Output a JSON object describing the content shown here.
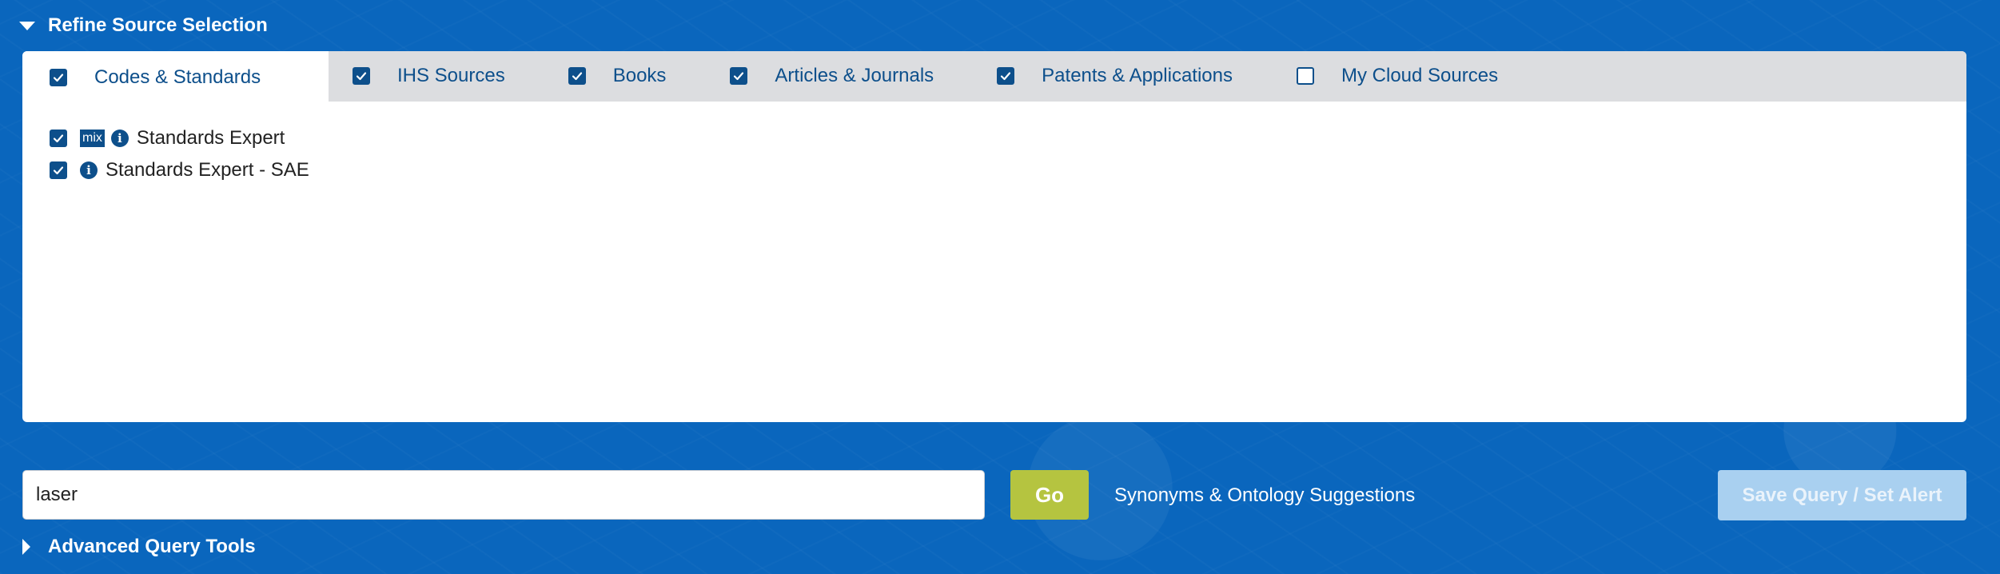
{
  "refine": {
    "title": "Refine Source Selection"
  },
  "tabs": [
    {
      "label": "Codes & Standards",
      "checked": true,
      "active": true
    },
    {
      "label": "IHS Sources",
      "checked": true,
      "active": false
    },
    {
      "label": "Books",
      "checked": true,
      "active": false
    },
    {
      "label": "Articles & Journals",
      "checked": true,
      "active": false
    },
    {
      "label": "Patents & Applications",
      "checked": true,
      "active": false
    },
    {
      "label": "My Cloud Sources",
      "checked": false,
      "active": false
    }
  ],
  "sources": [
    {
      "label": "Standards Expert",
      "badge": "mix",
      "checked": true
    },
    {
      "label": "Standards Expert - SAE",
      "checked": true
    }
  ],
  "icons": {
    "info": "info-icon",
    "check": "check-icon"
  },
  "search": {
    "value": "laser",
    "go_label": "Go",
    "synonyms_label": "Synonyms & Ontology Suggestions",
    "save_label": "Save Query / Set Alert"
  },
  "advanced": {
    "title": "Advanced Query Tools"
  },
  "colors": {
    "background": "#0a66bd",
    "accent": "#0d4f8b",
    "go_button": "#b5c440",
    "save_button": "#a9d0f0",
    "tabbar": "#dcdde0"
  }
}
